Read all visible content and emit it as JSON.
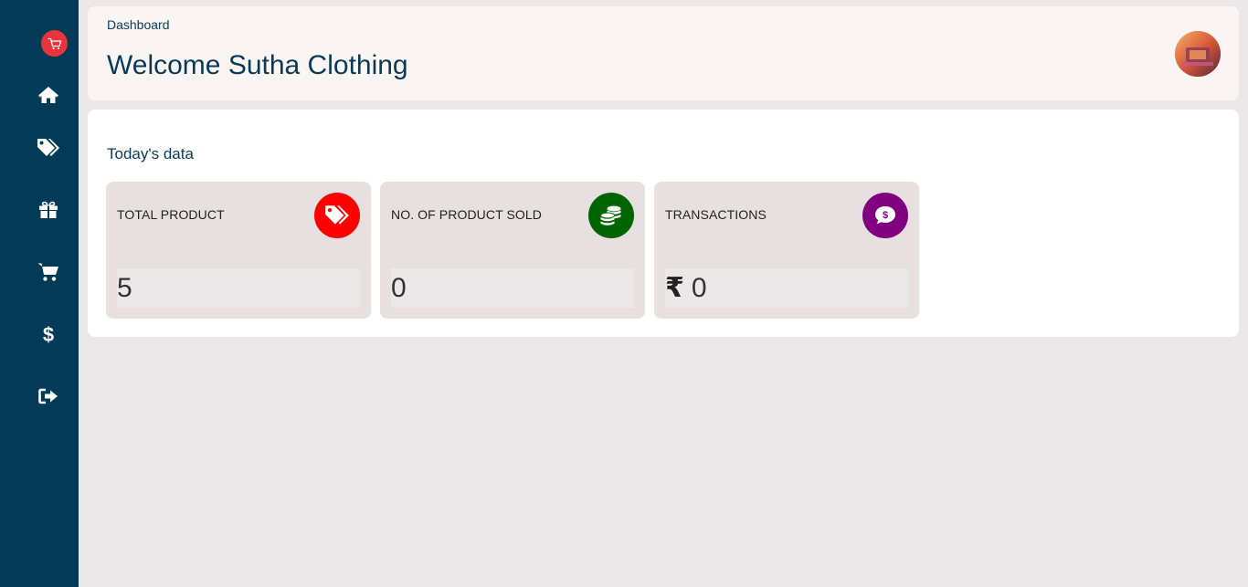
{
  "colors": {
    "sidebar_bg": "#023a57",
    "title_color": "#0a3a57",
    "header_bg": "#faf5f3",
    "card_bg": "#e6e0e0",
    "total_product_icon_bg": "#ff0000",
    "product_sold_icon_bg": "#006400",
    "transactions_icon_bg": "#800080",
    "logo_bg": "#e8343a"
  },
  "sidebar": {
    "logo_icon": "cart-outline-icon",
    "items": [
      {
        "name": "home",
        "icon": "home-icon"
      },
      {
        "name": "products",
        "icon": "tags-icon"
      },
      {
        "name": "gifts",
        "icon": "gift-icon"
      },
      {
        "name": "orders",
        "icon": "cart-icon"
      },
      {
        "name": "payments",
        "icon": "dollar-icon"
      },
      {
        "name": "logout",
        "icon": "sign-out-icon"
      }
    ]
  },
  "header": {
    "breadcrumb": "Dashboard",
    "title": "Welcome Sutha Clothing",
    "avatar_icon": "profile-avatar"
  },
  "main": {
    "section_title": "Today's data",
    "cards": [
      {
        "label": "TOTAL PRODUCT",
        "value": "5",
        "icon": "tags-icon"
      },
      {
        "label": "NO. OF PRODUCT SOLD",
        "value": "0",
        "icon": "coins-icon"
      },
      {
        "label": "TRANSACTIONS",
        "currency": "₹",
        "value": "0",
        "icon": "comment-dollar-icon"
      }
    ]
  }
}
